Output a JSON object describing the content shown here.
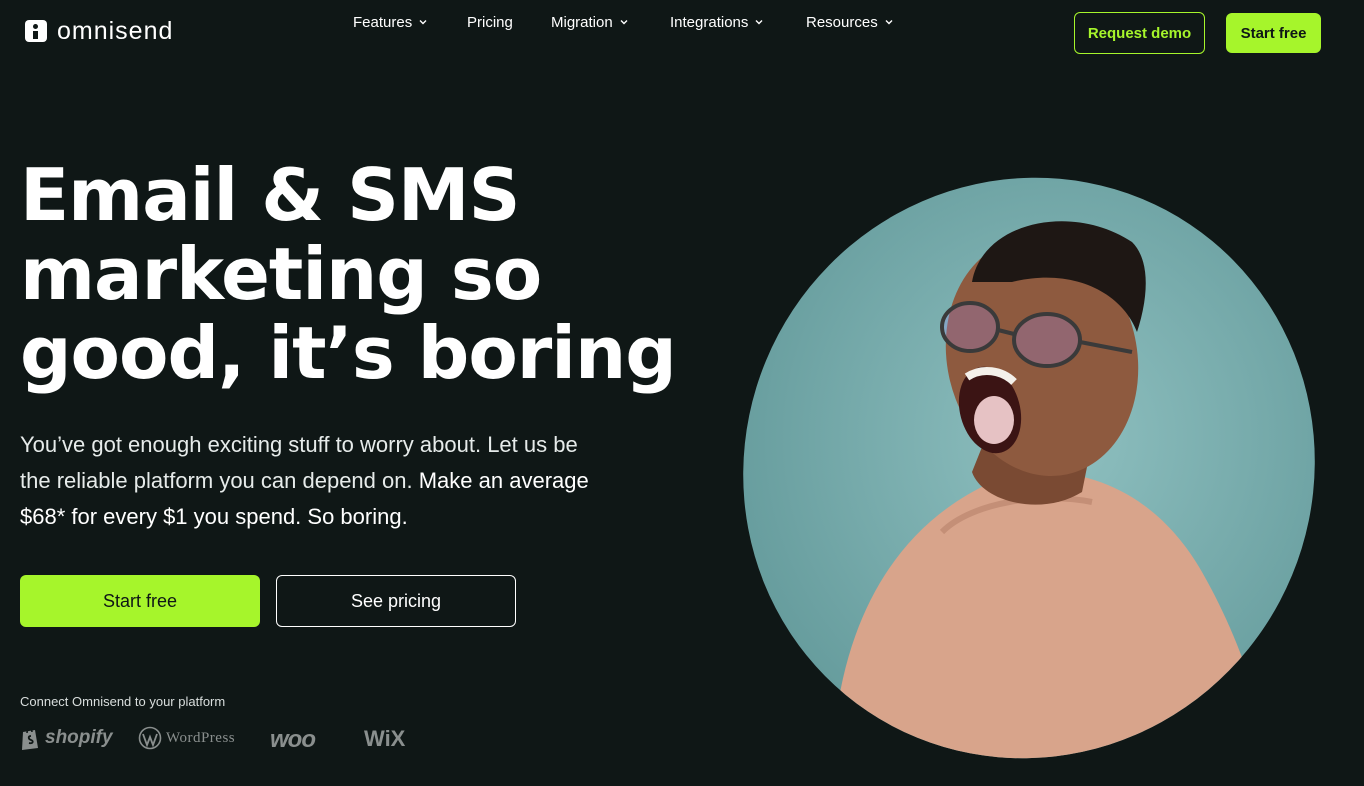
{
  "brand": {
    "name": "omnisend",
    "logo_icon": "omnisend-logo-icon"
  },
  "nav": {
    "items": [
      {
        "label": "Features",
        "has_dropdown": true
      },
      {
        "label": "Pricing",
        "has_dropdown": false
      },
      {
        "label": "Migration",
        "has_dropdown": true
      },
      {
        "label": "Integrations",
        "has_dropdown": true
      },
      {
        "label": "Resources",
        "has_dropdown": true
      }
    ],
    "request_demo_label": "Request demo",
    "start_free_label": "Start free"
  },
  "hero": {
    "headline_line1": "Email & SMS",
    "headline_line2": "marketing so",
    "headline_line3": "good, it’s boring",
    "subtext_light": "You’ve got enough exciting stuff to worry about. Let us be the reliable platform you can depend on.",
    "subtext_strong": "Make an average $68* for every $1 you spend. So boring.",
    "primary_cta": "Start free",
    "secondary_cta": "See pricing",
    "connect_label": "Connect Omnisend to your platform",
    "platforms": [
      "shopify",
      "WordPress",
      "woo",
      "WiX"
    ]
  },
  "colors": {
    "background": "#0f1716",
    "accent": "#a6f52b",
    "image_backdrop": "#6fa4a5"
  }
}
